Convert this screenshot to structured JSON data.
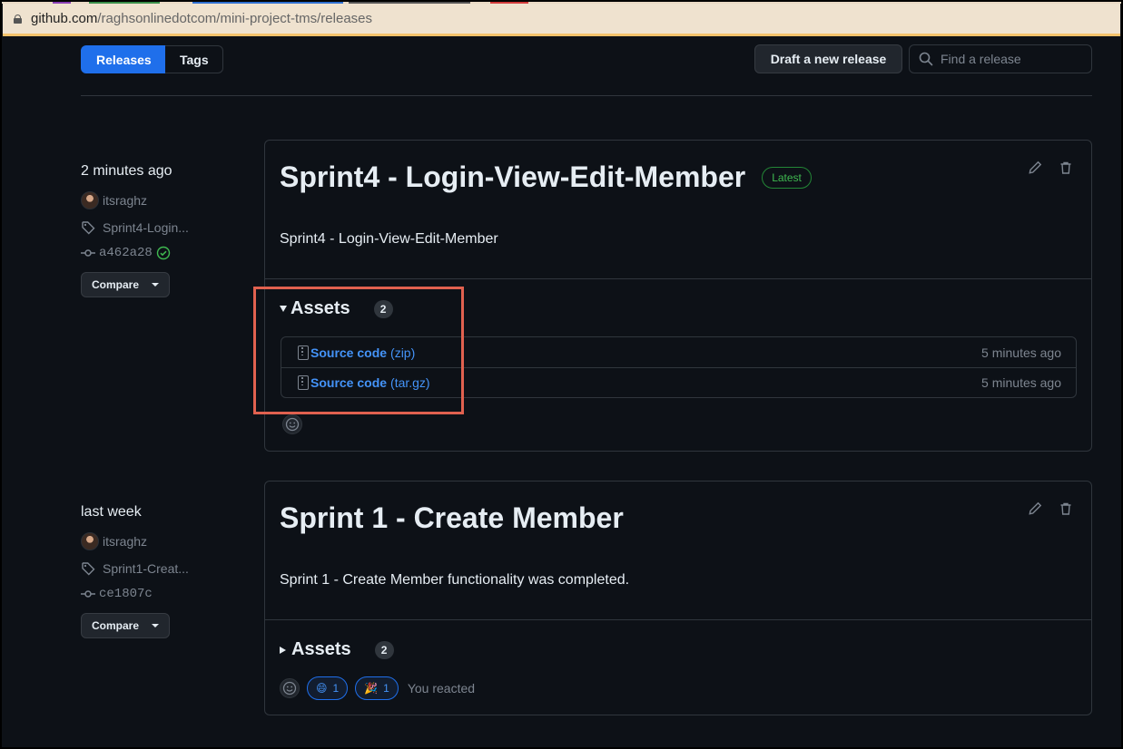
{
  "browser": {
    "url_host": "github.com",
    "url_path": "/raghsonlinedotcom/mini-project-tms/releases"
  },
  "toolbar": {
    "releases_label": "Releases",
    "tags_label": "Tags",
    "draft_label": "Draft a new release",
    "search_placeholder": "Find a release"
  },
  "releases": [
    {
      "when": "2 minutes ago",
      "author": "itsraghz",
      "tag": "Sprint4-Login...",
      "commit": "a462a28",
      "compare_label": "Compare",
      "title": "Sprint4 - Login-View-Edit-Member",
      "latest_label": "Latest",
      "description": "Sprint4 - Login-View-Edit-Member",
      "assets_label": "Assets",
      "assets_count": "2",
      "assets": [
        {
          "name": "Source code",
          "ext": "(zip)",
          "time": "5 minutes ago"
        },
        {
          "name": "Source code",
          "ext": "(tar.gz)",
          "time": "5 minutes ago"
        }
      ]
    },
    {
      "when": "last week",
      "author": "itsraghz",
      "tag": "Sprint1-Creat...",
      "commit": "ce1807c",
      "compare_label": "Compare",
      "title": "Sprint 1 - Create Member",
      "description": "Sprint 1 - Create Member functionality was completed.",
      "assets_label": "Assets",
      "assets_count": "2",
      "reactions": [
        {
          "emoji": "😄",
          "count": "1"
        },
        {
          "emoji": "🎉",
          "count": "1"
        }
      ],
      "reacted_label": "You reacted"
    }
  ],
  "colors": {
    "accent": "#1f6feb",
    "link": "#4493f8",
    "success": "#3fb950",
    "annotation": "#e0614f"
  }
}
